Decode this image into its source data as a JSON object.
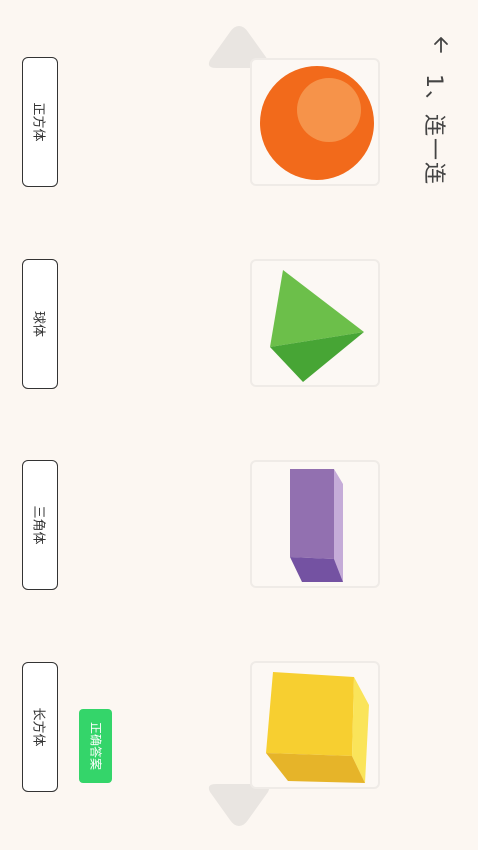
{
  "header": {
    "title": "1、连一连",
    "back_icon": "arrow-left-icon"
  },
  "colors": {
    "background": "#fcf7f2",
    "answer_button": "#34d56a",
    "arrow": "#e9e5e1"
  },
  "shapes": [
    {
      "name": "sphere",
      "color": "#f26a1b"
    },
    {
      "name": "triangular-pyramid",
      "color": "#5bb544"
    },
    {
      "name": "rectangular-prism",
      "color": "#9270b0"
    },
    {
      "name": "cube",
      "color": "#f7cf30"
    }
  ],
  "labels": [
    "正方体",
    "球体",
    "三角体",
    "长方体"
  ],
  "answer_button_label": "正确答案"
}
